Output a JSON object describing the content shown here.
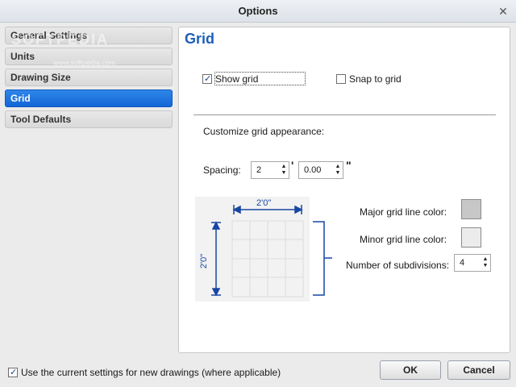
{
  "window": {
    "title": "Options"
  },
  "sidebar": {
    "items": [
      {
        "label": "General Settings"
      },
      {
        "label": "Units"
      },
      {
        "label": "Drawing Size"
      },
      {
        "label": "Grid"
      },
      {
        "label": "Tool Defaults"
      }
    ]
  },
  "panel": {
    "title": "Grid",
    "show_grid_label": "Show grid",
    "show_grid_checked": true,
    "snap_to_grid_label": "Snap to grid",
    "snap_to_grid_checked": false,
    "customize_label": "Customize grid appearance:",
    "spacing_label": "Spacing:",
    "spacing_feet": "2",
    "feet_unit": "'",
    "spacing_inches": "0.00",
    "inches_unit": "\"",
    "preview": {
      "width_label": "2'0\"",
      "height_label": "2'0\""
    },
    "major_color_label": "Major grid line color:",
    "major_color": "#c7c7c7",
    "minor_color_label": "Minor grid line color:",
    "minor_color": "#ececec",
    "subdivisions_label": "Number of subdivisions:",
    "subdivisions_value": "4"
  },
  "footer": {
    "use_current_label": "Use the current settings for new drawings (where applicable)",
    "use_current_checked": true,
    "ok_label": "OK",
    "cancel_label": "Cancel"
  },
  "colors": {
    "accent": "#1366d6",
    "title_blue": "#1d5fb8",
    "dimension_blue": "#1746a2"
  }
}
